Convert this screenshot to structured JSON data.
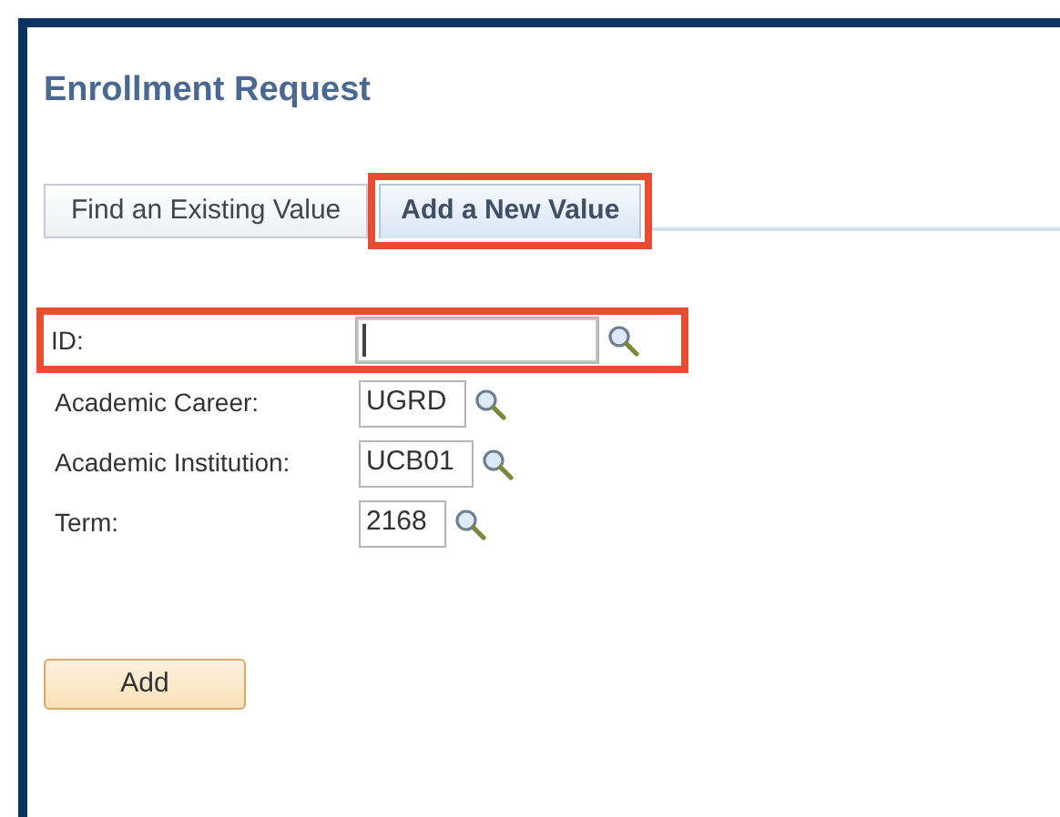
{
  "page": {
    "title": "Enrollment Request"
  },
  "tabs": [
    {
      "label": "Find an Existing Value",
      "selected": false,
      "highlighted": false
    },
    {
      "label": "Add a New Value",
      "selected": true,
      "highlighted": true
    }
  ],
  "fields": [
    {
      "label": "ID:",
      "focused": true,
      "highlighted": true
    },
    {
      "label": "Academic Career:",
      "value": "UGRD",
      "focused": false,
      "highlighted": false
    },
    {
      "label": "Academic Institution:",
      "value": "UCB01",
      "focused": false,
      "highlighted": false
    },
    {
      "label": "Term:",
      "value": "2168",
      "focused": false,
      "highlighted": false
    }
  ],
  "buttons": [
    "Add"
  ]
}
